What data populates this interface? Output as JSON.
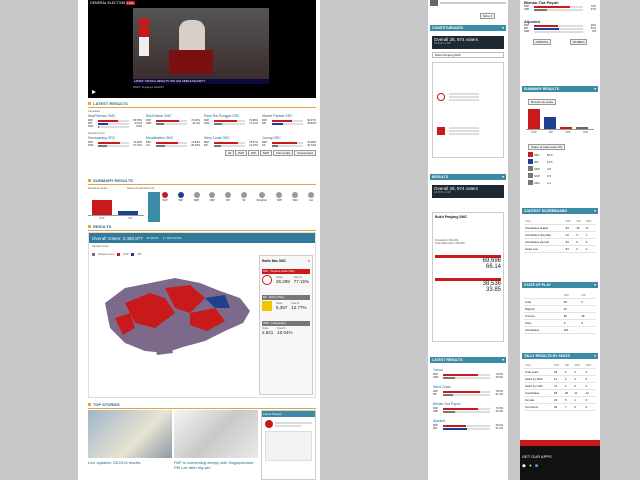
{
  "colors": {
    "pap": "#c81a1a",
    "wp": "#1f3f8f",
    "teal": "#3b8aa6",
    "accent": "#e2a340",
    "dark": "#1e2a33"
  },
  "video": {
    "header": "GENERAL ELECTION",
    "live_badge": "LIVE",
    "ticker": "LATEST: OFFICIAL RESULTS: PAP HAS SIMPLE MAJORITY",
    "caption": "Watch: Singapore GE2015"
  },
  "latest_results": {
    "title": "LATEST RESULTS",
    "group_a_label": "Contested",
    "group_b_label": "Sample Count",
    "constituencies": [
      {
        "name": "MacPherson SMC",
        "rows": [
          [
            "PAP",
            "65.58%"
          ],
          [
            "WP",
            "33.6%"
          ],
          [
            "NSP",
            "0.8%"
          ]
        ]
      },
      {
        "name": "Bukit Batok SMC",
        "rows": [
          [
            "PAP",
            "73.02%"
          ],
          [
            "SDP",
            "26.4%"
          ]
        ]
      },
      {
        "name": "Pasir Ris-Punggol GRC",
        "rows": [
          [
            "PAP",
            "72.89%"
          ],
          [
            "SDA",
            "27.11%"
          ]
        ]
      },
      {
        "name": "Marine Parade GRC",
        "rows": [
          [
            "PAP",
            "64.07%"
          ],
          [
            "WP",
            "35.93%"
          ]
        ]
      },
      {
        "name": "Sembawang GRC",
        "rows": [
          [
            "PAP",
            "72.28%"
          ],
          [
            "NSP",
            "27.72%"
          ]
        ]
      },
      {
        "name": "Mountbatten SMC",
        "rows": [
          [
            "PAP",
            "71.84%"
          ],
          [
            "Ind",
            "28.16%"
          ]
        ]
      },
      {
        "name": "West Coast GRC",
        "rows": [
          [
            "PAP",
            "78.57%"
          ],
          [
            "RP",
            "21.43%"
          ]
        ]
      },
      {
        "name": "Jurong GRC",
        "rows": [
          [
            "PAP",
            "79.28%"
          ],
          [
            "SF",
            "20.72%"
          ]
        ]
      }
    ],
    "tabs": [
      "All",
      "PAP",
      "WP",
      "SDP",
      "Full results",
      "Scoreboard"
    ]
  },
  "summary": {
    "title": "SUMMARY RESULTS",
    "seats_label": "Results by seats",
    "share_label": "Share of total Votes (%)",
    "bars": [
      {
        "party": "PAP",
        "value": 83
      },
      {
        "party": "WP",
        "value": 6
      }
    ],
    "parties": [
      "PAP",
      "WP",
      "SDP",
      "NSP",
      "RP",
      "SF",
      "SingFirst",
      "SPP",
      "SDA",
      "Ind"
    ]
  },
  "results": {
    "title": "RESULTS",
    "overall": "Overall Voters: 2,460,977",
    "seats_chip": "89 SEATS",
    "votes_chip": "1.7 MIN VOTES",
    "legend": [
      "Sample Count",
      "PAP",
      "WP"
    ],
    "detail": {
      "name": "Radin Mas SMC",
      "pap": {
        "label": "PAP · People's Action Party",
        "votes": "26,299",
        "pct": "77.15%"
      },
      "rp": {
        "label": "RP · Reform Party",
        "votes": "5,357",
        "pct": "12.77%"
      },
      "ind": {
        "label": "INDP · Independent",
        "votes": "2,621",
        "pct": "10.04%"
      },
      "votes_label": "Votes",
      "pct_label": "Vote %"
    }
  },
  "top_stories": {
    "title": "TOP STORIES",
    "story1": "Live updates: GE2015 results",
    "story2": "PAP is connecting deeply with Singaporeans: PM Lee after big win",
    "latest_tweets": "Latest Tweets"
  },
  "mid": {
    "constituency_head": "CONSTITUENCIES",
    "overall": "Overall 28, 974 voters",
    "sub": "All PAP vs WP",
    "select": "Bukit Panjang SMC",
    "results_head": "RESULTS",
    "result_title": "Bukit Panjang SMC",
    "population": "Population: 346,299",
    "valid": "Total Valid votes: 346,299",
    "pap_votes": "69,696",
    "pap_pct": "66.14",
    "sdp_votes": "38,536",
    "sdp_pct": "33.85",
    "latest_head": "LATEST RESULTS",
    "places": [
      {
        "name": "Yuhua",
        "rows": [
          [
            "PAP",
            "73.5%"
          ],
          [
            "SDP",
            "26.5%"
          ]
        ]
      },
      {
        "name": "West Coast",
        "rows": [
          [
            "PAP",
            "78.6%"
          ],
          [
            "RP",
            "21.4%"
          ]
        ]
      },
      {
        "name": "Bishan-Toa Payoh",
        "rows": [
          [
            "PAP",
            "73.6%"
          ],
          [
            "SPP",
            "26.4%"
          ]
        ]
      },
      {
        "name": "Aljunied",
        "rows": [
          [
            "PAP",
            "49.0%"
          ],
          [
            "WP",
            "51.0%"
          ]
        ]
      }
    ]
  },
  "right": {
    "bishan": "Bishan-Toa Payoh",
    "aljunied": "Aljunied",
    "top_rows": [
      [
        "PAP",
        "73%"
      ],
      [
        "SPP",
        "27%"
      ]
    ],
    "alj_rows": [
      [
        "PAP",
        "49%"
      ],
      [
        "WP",
        "51%"
      ],
      [
        "SDP",
        "0%"
      ]
    ],
    "btn1": "NORMAL",
    "btn2": "WOMEN",
    "summary_head": "SUMMARY RESULTS",
    "select": "Results by seats",
    "bar_parties": [
      "PAP",
      "WP",
      "SDP",
      "NSP"
    ],
    "share_label": "Share of total votes (%)",
    "share_rows": [
      [
        "PAP",
        "69.9"
      ],
      [
        "WP",
        "12.5"
      ],
      [
        "SDP",
        "3.8"
      ],
      [
        "NSP",
        "3.5"
      ],
      [
        "SDA",
        "2.1"
      ]
    ],
    "contest_head": "CONTEST SCOREBOARD",
    "contest_cols": [
      "Party",
      "PAP",
      "WP",
      "SDP"
    ],
    "contest_rows": [
      [
        "Candidates fielded",
        "89",
        "28",
        "11"
      ],
      [
        "Candidates (Female)",
        "20",
        "5",
        "1"
      ],
      [
        "Candidates elected",
        "83",
        "6",
        "0"
      ],
      [
        "Seats won",
        "83",
        "6",
        "0"
      ]
    ],
    "state_head": "STATE OF PLAY",
    "state_cols": [
      "",
      "PAP",
      "WP"
    ],
    "state_rows": [
      [
        "Total",
        "83",
        "6"
      ],
      [
        "Majority",
        "46",
        ""
      ],
      [
        "Contest",
        "89",
        "28"
      ],
      [
        "Party",
        "9",
        "9"
      ],
      [
        "Candidates",
        "181",
        ""
      ]
    ],
    "tally_head": "TALLY RESULTS BY SEATS",
    "tally_cols": [
      "Party",
      "PAP",
      "WP",
      "SDP",
      "NSP"
    ],
    "tally_rows": [
      [
        "Total seats",
        "83",
        "6",
        "0",
        "0"
      ],
      [
        "Seats by SMC",
        "11",
        "2",
        "0",
        "0"
      ],
      [
        "Seats by GRC",
        "72",
        "4",
        "0",
        "0"
      ],
      [
        "Candidates",
        "89",
        "28",
        "11",
        "12"
      ],
      [
        "Female",
        "20",
        "5",
        "1",
        "0"
      ],
      [
        "Incumbent",
        "66",
        "7",
        "0",
        "0"
      ]
    ],
    "app_head": "GET OUR APPS"
  }
}
